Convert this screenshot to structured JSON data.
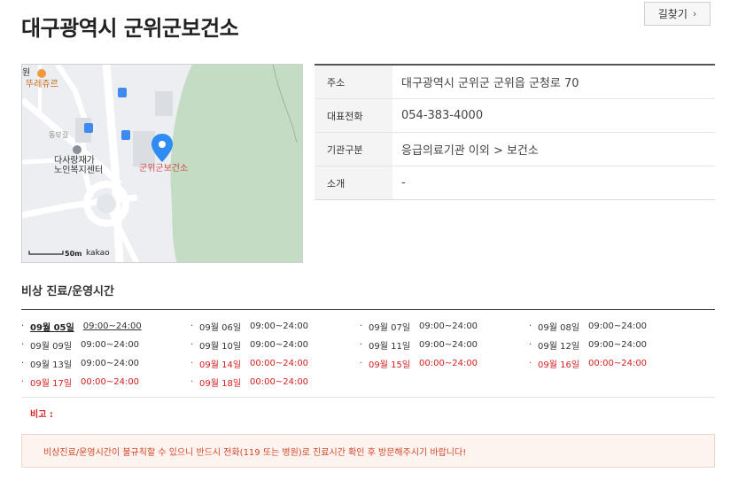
{
  "page": {
    "title": "대구광역시 군위군보건소"
  },
  "route_button": {
    "label": "길찾기",
    "icon": "chevron-right-icon"
  },
  "map": {
    "labels": {
      "cafe": "뚜레쥬르",
      "center_line1": "다사랑재가",
      "center_line2": "노인복지센터",
      "place": "군위군보건소",
      "road": "동부길",
      "edge": "원",
      "scale": "50m",
      "brand": "kakao"
    }
  },
  "info": {
    "rows": [
      {
        "key": "주소",
        "value": "대구광역시 군위군 군위읍 군청로 70"
      },
      {
        "key": "대표전화",
        "value": "054-383-4000"
      },
      {
        "key": "기관구분",
        "value": "응급의료기관 이외 > 보건소"
      },
      {
        "key": "소개",
        "value": "-"
      }
    ]
  },
  "schedule": {
    "title": "비상 진료/운영시간",
    "rows": [
      [
        {
          "date": "09월 05일",
          "time": "09:00~24:00"
        },
        {
          "date": "09월 06일",
          "time": "09:00~24:00"
        },
        {
          "date": "09월 07일",
          "time": "09:00~24:00"
        },
        {
          "date": "09월 08일",
          "time": "09:00~24:00"
        }
      ],
      [
        {
          "date": "09월 09일",
          "time": "09:00~24:00"
        },
        {
          "date": "09월 10일",
          "time": "09:00~24:00"
        },
        {
          "date": "09월 11일",
          "time": "09:00~24:00"
        },
        {
          "date": "09월 12일",
          "time": "09:00~24:00"
        }
      ],
      [
        {
          "date": "09월 13일",
          "time": "09:00~24:00"
        },
        {
          "date": "09월 14일",
          "time": "00:00~24:00"
        },
        {
          "date": "09월 15일",
          "time": "00:00~24:00"
        },
        {
          "date": "09월 16일",
          "time": "00:00~24:00"
        }
      ],
      [
        {
          "date": "09월 17일",
          "time": "00:00~24:00"
        },
        {
          "date": "09월 18일",
          "time": "00:00~24:00"
        }
      ]
    ],
    "note_label": "비고 :",
    "notice": "비상진료/운영시간이 불규칙할 수 있으니 반드시 전화(119 또는 병원)로 진료시간 확인 후 방문해주시기 바랍니다!"
  },
  "colors": {
    "holiday_red": "#d62020",
    "notice_text": "#d2472a",
    "map_park": "#c3dcc3",
    "marker_blue": "#2f8cf3"
  }
}
